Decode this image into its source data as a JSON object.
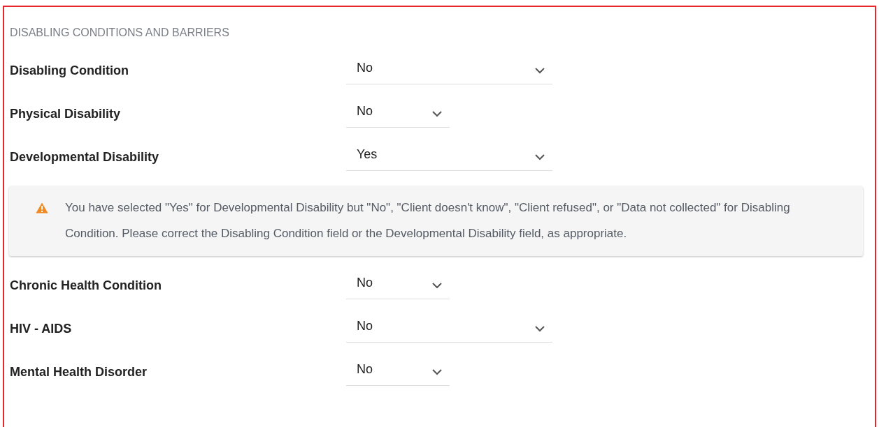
{
  "section": {
    "title": "DISABLING CONDITIONS AND BARRIERS"
  },
  "fields": [
    {
      "label": "Disabling Condition",
      "value": "No",
      "kind": "wide"
    },
    {
      "label": "Physical Disability",
      "value": "No",
      "kind": "narrow"
    },
    {
      "label": "Developmental Disability",
      "value": "Yes",
      "kind": "wide"
    },
    {
      "kind": "warning",
      "message": "You have selected \"Yes\" for Developmental Disability but \"No\", \"Client doesn't know\", \"Client refused\", or \"Data not collected\" for Disabling Condition. Please correct the Disabling Condition field or the Developmental Disability field, as appropriate."
    },
    {
      "label": "Chronic Health Condition",
      "value": "No",
      "kind": "narrow"
    },
    {
      "label": "HIV - AIDS",
      "value": "No",
      "kind": "wide"
    },
    {
      "label": "Mental Health Disorder",
      "value": "No",
      "kind": "narrow"
    }
  ]
}
